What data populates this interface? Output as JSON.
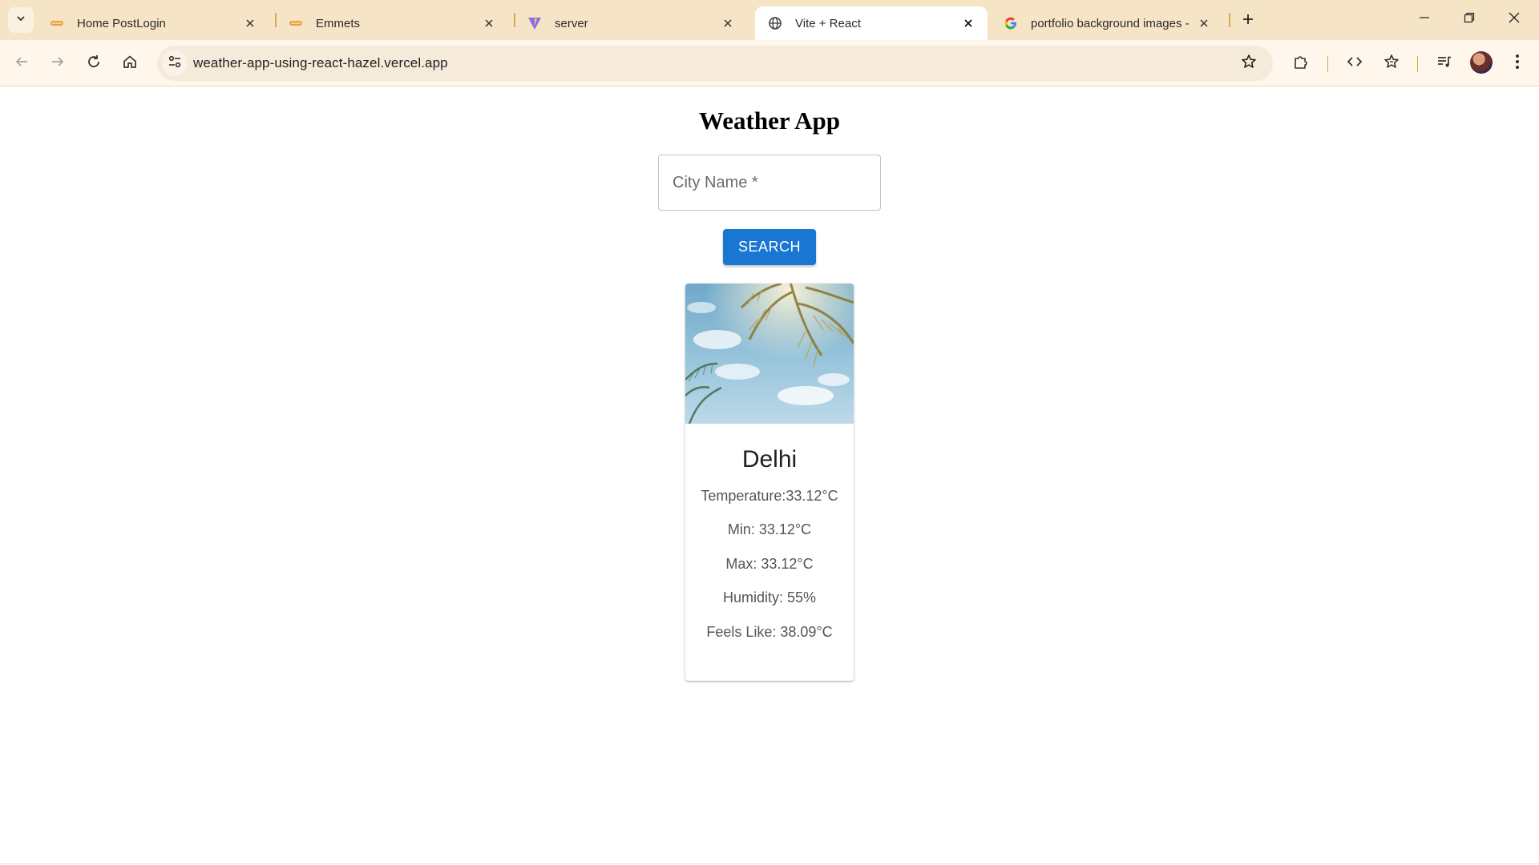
{
  "browser": {
    "tabs": [
      {
        "title": "Home PostLogin",
        "favicon": "codepen-favicon",
        "active": false
      },
      {
        "title": "Emmets",
        "favicon": "codepen-favicon",
        "active": false
      },
      {
        "title": "server",
        "favicon": "vite-favicon",
        "active": false
      },
      {
        "title": "Vite + React",
        "favicon": "globe-favicon",
        "active": true
      },
      {
        "title": "portfolio background images -",
        "favicon": "google-favicon",
        "active": false
      }
    ],
    "url": "weather-app-using-react-hazel.vercel.app",
    "colors": {
      "tab_strip": "#f6e4c7",
      "toolbar": "#fff6ec",
      "omnibox": "#f6ebdb",
      "separator": "#e0a74a"
    }
  },
  "app": {
    "title": "Weather App",
    "search": {
      "placeholder": "City Name *",
      "button_label": "SEARCH",
      "button_color": "#1976d2"
    },
    "card": {
      "city": "Delhi",
      "stats": [
        "Temperature:33.12°C",
        "Min: 33.12°C",
        "Max: 33.12°C",
        "Humidity: 55%",
        "Feels Like: 38.09°C"
      ]
    }
  }
}
